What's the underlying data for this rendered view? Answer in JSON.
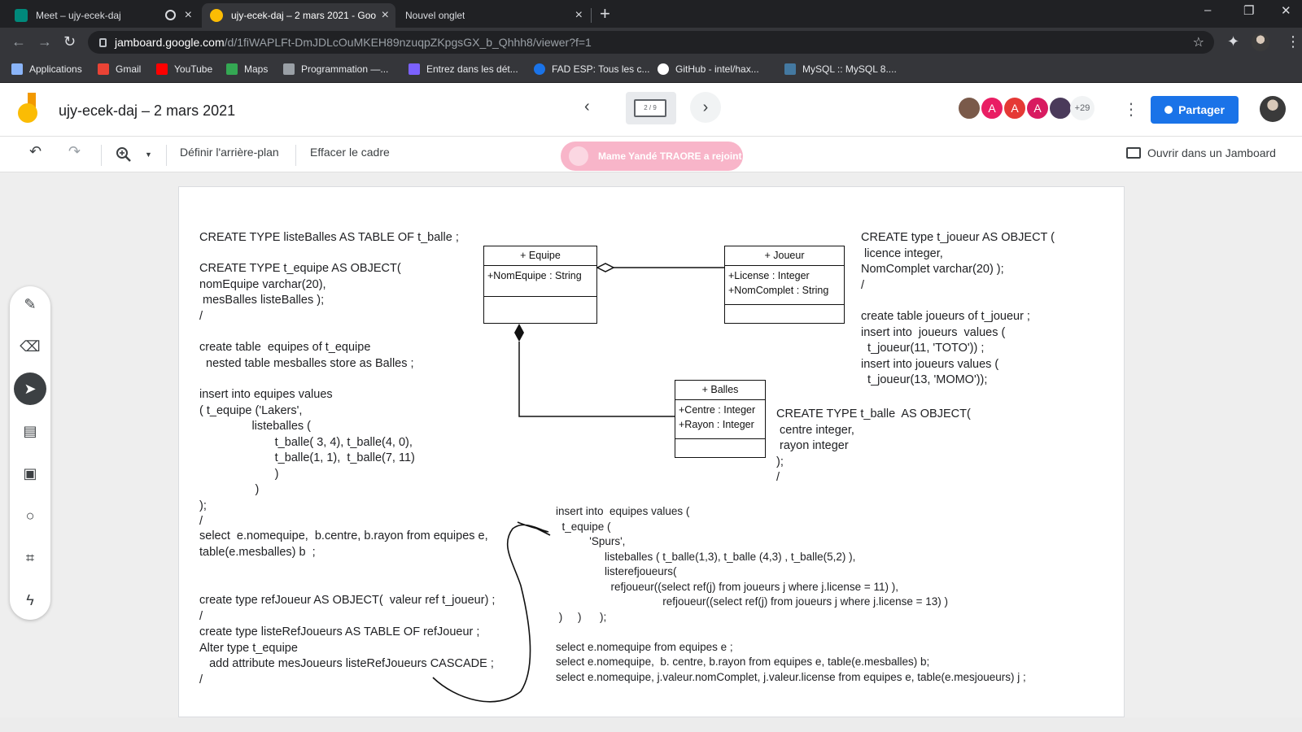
{
  "tabs": [
    {
      "title": "Meet – ujy-ecek-daj",
      "active": false
    },
    {
      "title": "ujy-ecek-daj – 2 mars 2021 - Goo",
      "active": true
    },
    {
      "title": "Nouvel onglet",
      "active": false
    }
  ],
  "window_controls": {
    "minimize": "–",
    "restore": "❐",
    "close": "✕"
  },
  "address": {
    "host": "jamboard.google.com",
    "path": "/d/1fiWAPLFt-DmJDLcOuMKEH89nzuqpZKpgsGX_b_Qhhh8/viewer?f=1"
  },
  "bookmarks": [
    {
      "label": "Applications",
      "color": "#8ab4f8"
    },
    {
      "label": "Gmail",
      "color": "#ea4335"
    },
    {
      "label": "YouTube",
      "color": "#ff0000"
    },
    {
      "label": "Maps",
      "color": "#34a853"
    },
    {
      "label": "Programmation —...",
      "color": "#9aa0a6"
    },
    {
      "label": "Entrez dans les dét...",
      "color": "#7b61ff"
    },
    {
      "label": "FAD ESP: Tous les c...",
      "color": "#1a73e8"
    },
    {
      "label": "GitHub - intel/hax...",
      "color": "#ffffff"
    },
    {
      "label": "MySQL :: MySQL 8....",
      "color": "#4479a1"
    }
  ],
  "header": {
    "title": "ujy-ecek-daj – 2 mars 2021",
    "frame_indicator": "2 / 9",
    "avatars": [
      {
        "initial": "",
        "color": "#7a5a4a"
      },
      {
        "initial": "A",
        "color": "#e91e63"
      },
      {
        "initial": "A",
        "color": "#e53935"
      },
      {
        "initial": "A",
        "color": "#d81b60"
      },
      {
        "initial": "",
        "color": "#4a3a5a"
      }
    ],
    "more_count": "+29",
    "share_label": "Partager"
  },
  "toolbar": {
    "background_label": "Définir l'arrière-plan",
    "clear_label": "Effacer le cadre",
    "toast": "Mame Yandé TRAORE a rejoint",
    "open_label": "Ouvrir dans un Jamboard"
  },
  "canvas": {
    "left_notes": [
      "CREATE TYPE listeBalles AS TABLE OF t_balle ;",
      "CREATE TYPE t_equipe AS OBJECT(\nnomEquipe varchar(20),\n mesBalles listeBalles );\n/",
      "create table  equipes of t_equipe\n  nested table mesballes store as Balles ;",
      "insert into equipes values\n( t_equipe ('Lakers',\n                listeballes (\n                       t_balle( 3, 4), t_balle(4, 0),\n                       t_balle(1, 1),  t_balle(7, 11)\n                       )\n                 )\n);\n/",
      "select  e.nomequipe,  b.centre, b.rayon from equipes e,\ntable(e.mesballes) b  ;",
      "create type refJoueur AS OBJECT(  valeur ref t_joueur) ;\n/\ncreate type listeRefJoueurs AS TABLE OF refJoueur ;\nAlter type t_equipe\n   add attribute mesJoueurs listeRefJoueurs CASCADE ;\n/"
    ],
    "right_notes": [
      "CREATE type t_joueur AS OBJECT (\n licence integer,\nNomComplet varchar(20) );\n/",
      "create table joueurs of t_joueur ;\ninsert into  joueurs  values (\n  t_joueur(11, 'TOTO')) ;\ninsert into joueurs values (\n  t_joueur(13, 'MOMO'));"
    ],
    "balle_note": "CREATE TYPE t_balle  AS OBJECT(\n centre integer,\n rayon integer\n);\n/",
    "bottom_note": "insert into  equipes values (\n  t_equipe (\n           'Spurs',\n                listeballes ( t_balle(1,3), t_balle (4,3) , t_balle(5,2) ),\n                listerefjoueurs(\n                  refjoueur((select ref(j) from joueurs j where j.license = 11) ),\n                                   refjoueur((select ref(j) from joueurs j where j.license = 13) )\n )     )      );\n\nselect e.nomequipe from equipes e ;\nselect e.nomequipe,  b. centre, b.rayon from equipes e, table(e.mesballes) b;\nselect e.nomequipe, j.valeur.nomComplet, j.valeur.license from equipes e, table(e.mesjoueurs) j ;",
    "uml": {
      "equipe": {
        "name": "+ Equipe",
        "attrs": "+NomEquipe : String"
      },
      "joueur": {
        "name": "+ Joueur",
        "attrs": "+License : Integer\n+NomComplet : String"
      },
      "balles": {
        "name": "+ Balles",
        "attrs": "+Centre : Integer\n+Rayon : Integer"
      }
    }
  }
}
